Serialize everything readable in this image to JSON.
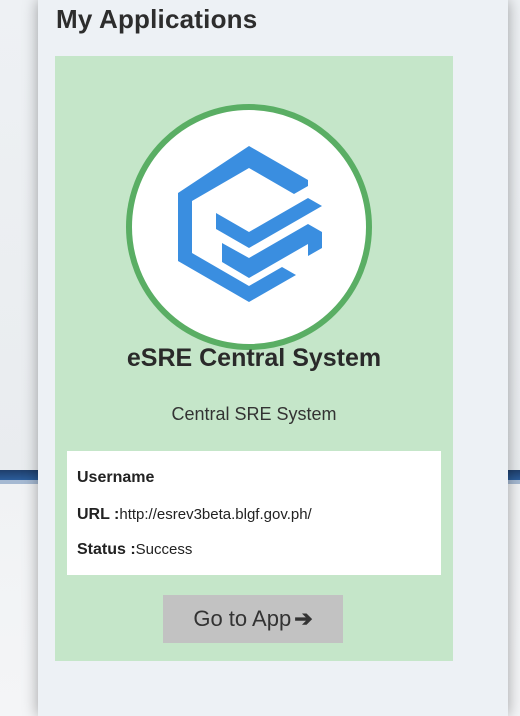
{
  "panel": {
    "title": "My Applications"
  },
  "app": {
    "name": "eSRE Central System",
    "description": "Central SRE System",
    "username_label": "Username",
    "url_label": "URL :",
    "url_value": "http://esrev3beta.blgf.gov.ph/",
    "status_label": "Status :",
    "status_value": "Success",
    "button_label": "Go to App",
    "button_icon": "arrow-right-icon",
    "logo_icon": "esre-logo-icon"
  },
  "colors": {
    "card_background": "#c5e6c9",
    "logo_ring": "#5aae64",
    "logo_blue": "#3a8ee0",
    "button_background": "#c2c2c2"
  }
}
